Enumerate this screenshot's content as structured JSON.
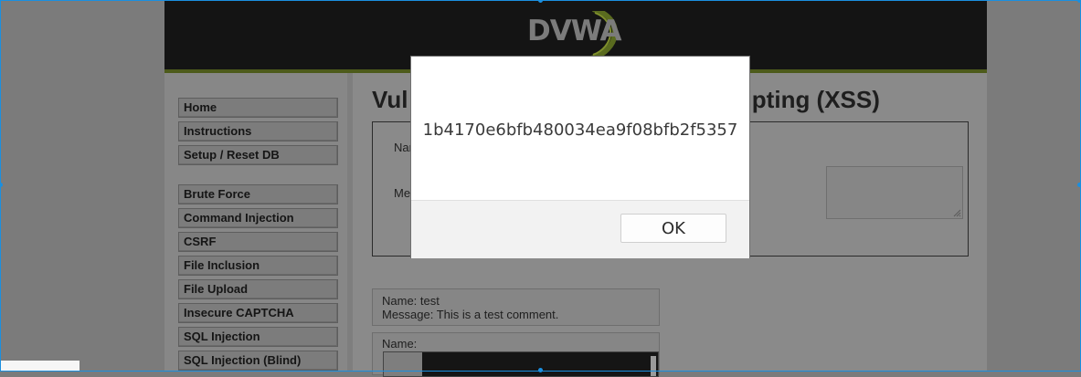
{
  "header": {
    "logo_text": "DVWA"
  },
  "menu": {
    "group1": [
      "Home",
      "Instructions",
      "Setup / Reset DB"
    ],
    "group2": [
      "Brute Force",
      "Command Injection",
      "CSRF",
      "File Inclusion",
      "File Upload",
      "Insecure CAPTCHA",
      "SQL Injection",
      "SQL Injection (Blind)"
    ]
  },
  "main": {
    "title_left": "Vul",
    "title_right": "cripting (XSS)",
    "form": {
      "name_label_partial": "Nan",
      "message_label_partial": "Me"
    },
    "comments": [
      {
        "name_line": "Name: test",
        "message_line": "Message: This is a test comment."
      },
      {
        "name_line": "Name:"
      }
    ]
  },
  "dialog": {
    "message": "1b4170e6bfb480034ea9f08bfb2f5357",
    "ok_label": "OK"
  },
  "colors": {
    "header_bg": "#141414",
    "logo_accent": "#8fa02a",
    "selection": "#1a8fe0"
  }
}
